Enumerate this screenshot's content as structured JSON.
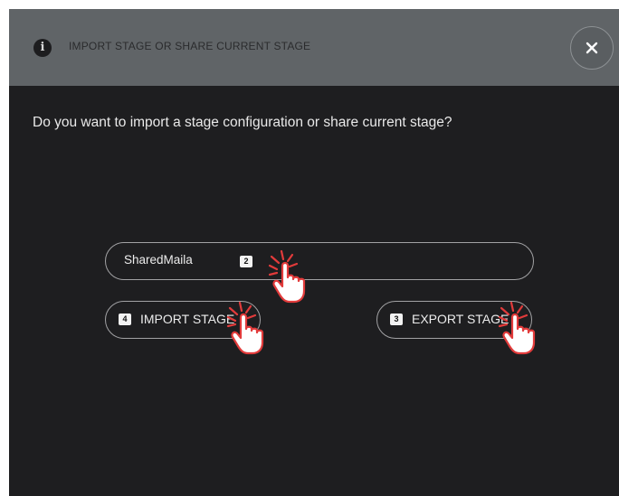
{
  "dialog": {
    "title": "IMPORT STAGE OR SHARE CURRENT STAGE",
    "info_icon": "info-icon",
    "close_icon": "close-icon",
    "question": "Do you want to import a stage configuration or share current stage?"
  },
  "share_input": {
    "value": "SharedMaila",
    "step": "2"
  },
  "import_button": {
    "label": "IMPORT STAGE",
    "step": "4"
  },
  "export_button": {
    "label": "EXPORT STAGE",
    "step": "3"
  },
  "annotations": {
    "pointer_icon": "hand-pointer-click-icon",
    "pointer_color": "#e23b3b"
  },
  "colors": {
    "header_bg": "#606467",
    "dialog_bg": "#1e1e20",
    "border": "#a2a2a4",
    "text": "#ececec"
  }
}
